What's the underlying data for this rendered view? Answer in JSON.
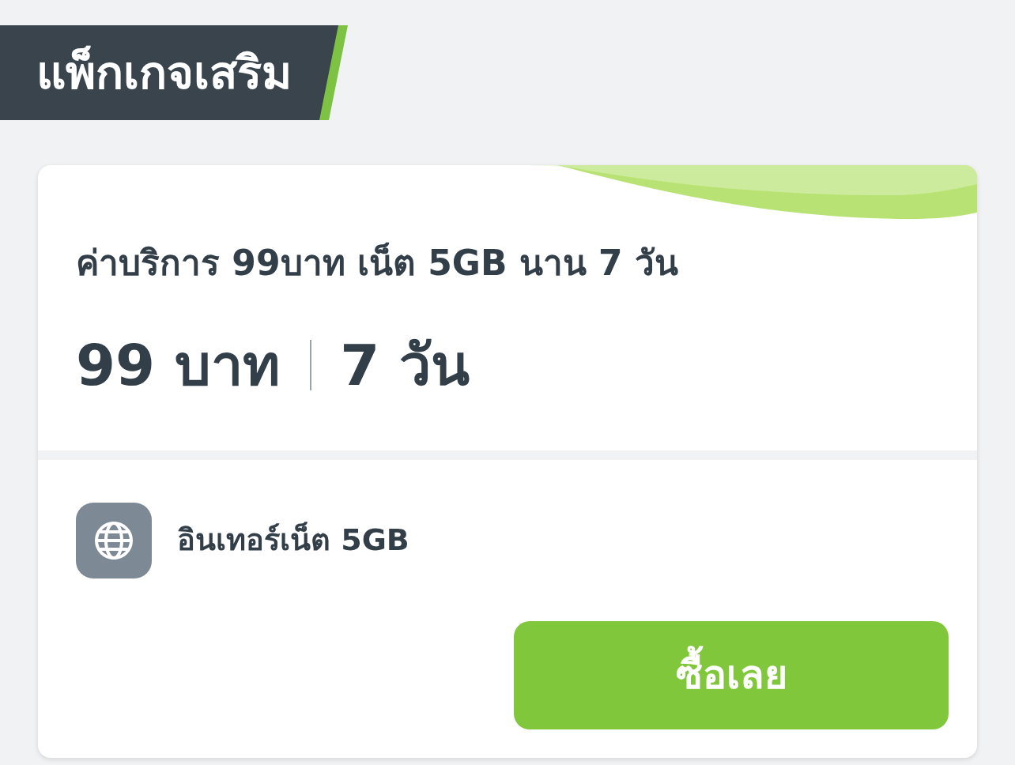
{
  "header": {
    "title": "แพ็กเกจเสริม"
  },
  "package": {
    "title": "ค่าบริการ 99บาท เน็ต 5GB นาน 7 วัน",
    "price": "99 บาท",
    "duration": "7 วัน",
    "features": [
      {
        "label": "อินเทอร์เน็ต 5GB"
      }
    ],
    "button": "ซื้อเลย"
  }
}
